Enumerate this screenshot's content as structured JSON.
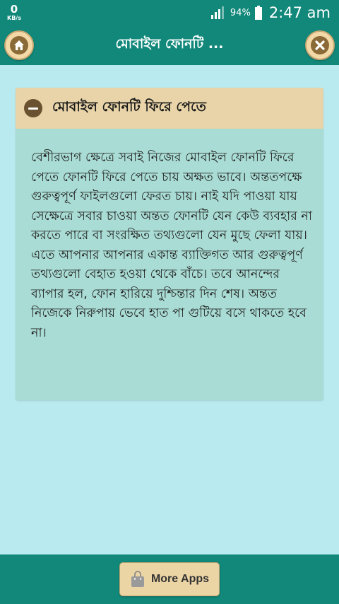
{
  "status_bar": {
    "net_speed": "0",
    "net_unit": "KB/s",
    "battery": "94%",
    "time": "2:47 am"
  },
  "header": {
    "title": "মোবাইল ফোনটি ..."
  },
  "card": {
    "title": "মোবাইল ফোনটি ফিরে পেতে",
    "body": "বেশীরভাগ ক্ষেত্রে সবাই নিজের মোবাইল ফোনটি ফিরে পেতে ফোনটি ফিরে পেতে চায় অক্ষত ভাবে। অন্ততপক্ষে গুরুত্বপূর্ণ ফাইলগুলো ফেরত চায়। নাই যদি পাওয়া যায় সেক্ষেত্রে সবার চাওয়া অন্তত ফোনটি যেন কেউ ব্যবহার না করতে পারে বা সংরক্ষিত তথ্যগুলো যেন মুছে ফেলা যায়। এতে আপনার আপনার একান্ত ব্যাক্তিগত আর গুরুত্বপূর্ণ তথ্যগুলো বেহাত হওয়া থেকে বাঁচে। তবে আনন্দের ব্যাপার হল, ফোন হারিয়ে দুশ্চিন্তার দিন শেষ। অন্তত নিজেকে নিরুপায় ভেবে হাত পা গুটিয়ে বসে থাকতে হবে না।"
  },
  "footer": {
    "more_apps_label": "More Apps"
  },
  "icons": {
    "home": "home-icon",
    "close": "close-icon",
    "collapse": "minus-icon",
    "bag": "shopping-bag-icon"
  },
  "colors": {
    "primary": "#11887a",
    "background": "#b9eaf0",
    "card": "#a9dcd4",
    "card_header": "#e8d4a8",
    "button": "#ecd5a5"
  }
}
